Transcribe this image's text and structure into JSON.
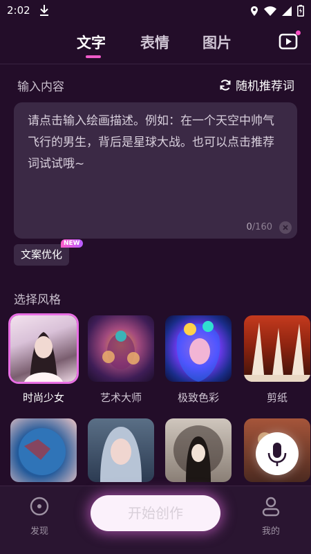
{
  "status_bar": {
    "time": "2:02"
  },
  "tabs": [
    {
      "label": "文字",
      "active": true
    },
    {
      "label": "表情",
      "active": false
    },
    {
      "label": "图片",
      "active": false
    }
  ],
  "input": {
    "label": "输入内容",
    "random_label": "随机推荐词",
    "placeholder": "请点击输入绘画描述。例如：在一个天空中帅气飞行的男生，背后是星球大战。也可以点击推荐词试试哦~",
    "count_current": "0",
    "count_max": "/160"
  },
  "optimize": {
    "label": "文案优化",
    "badge": "NEW"
  },
  "styles": {
    "label": "选择风格",
    "items": [
      {
        "name": "时尚少女",
        "selected": true
      },
      {
        "name": "艺术大师",
        "selected": false
      },
      {
        "name": "极致色彩",
        "selected": false
      },
      {
        "name": "剪纸",
        "selected": false
      }
    ]
  },
  "bottom_nav": {
    "discover": "发现",
    "create": "开始创作",
    "mine": "我的"
  },
  "colors": {
    "accent": "#f05bc9",
    "background": "#230d29",
    "panel": "#3b2945"
  }
}
